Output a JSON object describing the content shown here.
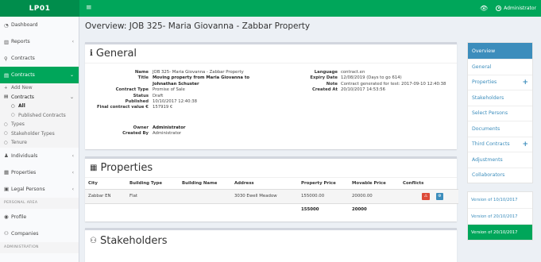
{
  "brand": "LP01",
  "topbar": {
    "user": "Administrator"
  },
  "sidebar": {
    "items": [
      {
        "label": "Dashboard",
        "icon": "dashboard-icon"
      },
      {
        "label": "Reports",
        "icon": "chart-icon"
      },
      {
        "label": "Contracts",
        "icon": "search-icon"
      },
      {
        "label": "Contracts",
        "icon": "file-icon"
      }
    ],
    "sub": {
      "add_new": "Add New",
      "contracts": "Contracts",
      "all": "All",
      "published": "Published Contracts",
      "types": "Types",
      "stakeholder_types": "Stakeholder Types",
      "tenure": "Tenure"
    },
    "individuals": "Individuals",
    "properties": "Properties",
    "legal_persons": "Legal Persons",
    "personal_area": "PERSONAL AREA",
    "profile": "Profile",
    "companies": "Companies",
    "administration": "ADMINISTRATION"
  },
  "page_title": "Overview: JOB 325- Maria Giovanna - Zabbar Property",
  "general": {
    "title": "General",
    "name_k": "Name",
    "name_v": "JOB 325- Maria Giovanna - Zabbar Property",
    "title_k": "Title",
    "title_v1": "Moving property from Maria Giovanna to",
    "title_v2": "Johnathan Schuster",
    "ctype_k": "Contract Type",
    "ctype_v": "Promise of Sale",
    "status_k": "Status",
    "status_v": "Draft",
    "published_k": "Published",
    "published_v": "10/10/2017 12:40:38",
    "final_k": "Final contract value €",
    "final_v": "157919 €",
    "owner_k": "Owner",
    "owner_v": "Administrator",
    "created_by_k": "Created By",
    "created_by_v": "Administrator",
    "lang_k": "Language",
    "lang_v": "contract.en",
    "expiry_k": "Expiry Date",
    "expiry_v": "12/08/2019 (Days to go 614)",
    "note_k": "Note",
    "note_v": "Contract generated for test: 2017-09-10 12:40:38",
    "created_at_k": "Created At",
    "created_at_v": "20/10/2017 14:53:56"
  },
  "properties": {
    "title": "Properties",
    "headers": [
      "City",
      "Building Type",
      "Building Name",
      "Address",
      "Property Price",
      "Movable Price",
      "Conflicts"
    ],
    "row": {
      "city": "Zabbar EN",
      "btype": "Flat",
      "bname": "",
      "address": "3030 Ewell Meadow",
      "pprice": "155000.00",
      "mprice": "20000.00"
    },
    "totals": {
      "pprice": "155000",
      "mprice": "20000"
    }
  },
  "stakeholders": {
    "title": "Stakeholders"
  },
  "rnav": {
    "items": [
      "Overview",
      "General",
      "Properties",
      "Stakeholders",
      "Select Persons",
      "Documents",
      "Third Contracts",
      "Adjustments",
      "Collaborators"
    ],
    "versions": [
      "Version of 10/10/2017",
      "Version of 20/10/2017",
      "Version of 20/10/2017"
    ]
  },
  "colors": {
    "green": "#00a65a",
    "green_dark": "#008d4c",
    "blue": "#3c8dbc",
    "red": "#dd4b39"
  }
}
